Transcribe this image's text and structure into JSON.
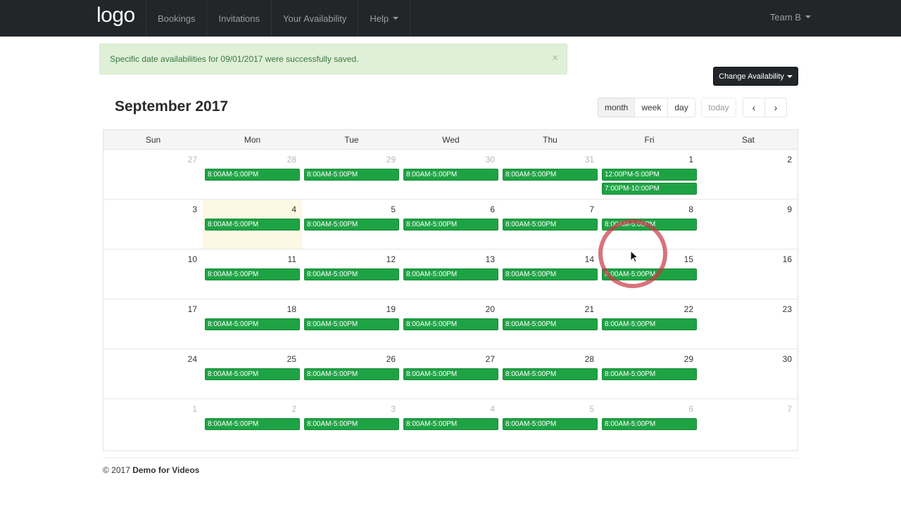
{
  "navbar": {
    "logo": "logo",
    "items": [
      {
        "label": "Bookings"
      },
      {
        "label": "Invitations"
      },
      {
        "label": "Your Availability"
      },
      {
        "label": "Help"
      }
    ],
    "team": "Team B"
  },
  "alert": {
    "message": "Specific date availabilities for 09/01/2017 were successfully saved.",
    "close": "×"
  },
  "change_availability": "Change Availability",
  "calendar": {
    "title": "September 2017",
    "views": {
      "month": "month",
      "week": "week",
      "day": "day"
    },
    "today": "today",
    "prev": "‹",
    "next": "›",
    "days_of_week": [
      "Sun",
      "Mon",
      "Tue",
      "Wed",
      "Thu",
      "Fri",
      "Sat"
    ],
    "weeks": [
      {
        "days": [
          {
            "num": "27",
            "other": true,
            "events": []
          },
          {
            "num": "28",
            "other": true,
            "events": [
              "8:00AM-5:00PM"
            ]
          },
          {
            "num": "29",
            "other": true,
            "events": [
              "8:00AM-5:00PM"
            ]
          },
          {
            "num": "30",
            "other": true,
            "events": [
              "8:00AM-5:00PM"
            ]
          },
          {
            "num": "31",
            "other": true,
            "events": [
              "8:00AM-5:00PM"
            ]
          },
          {
            "num": "1",
            "other": false,
            "events": [
              "12:00PM-5:00PM",
              "7:00PM-10:00PM"
            ]
          },
          {
            "num": "2",
            "other": false,
            "events": []
          }
        ]
      },
      {
        "days": [
          {
            "num": "3",
            "other": false,
            "events": []
          },
          {
            "num": "4",
            "other": false,
            "today": true,
            "events": [
              "8:00AM-5:00PM"
            ]
          },
          {
            "num": "5",
            "other": false,
            "events": [
              "8:00AM-5:00PM"
            ]
          },
          {
            "num": "6",
            "other": false,
            "events": [
              "8:00AM-5:00PM"
            ]
          },
          {
            "num": "7",
            "other": false,
            "events": [
              "8:00AM-5:00PM"
            ]
          },
          {
            "num": "8",
            "other": false,
            "events": [
              "8:00AM-5:00PM"
            ]
          },
          {
            "num": "9",
            "other": false,
            "events": []
          }
        ]
      },
      {
        "days": [
          {
            "num": "10",
            "other": false,
            "events": []
          },
          {
            "num": "11",
            "other": false,
            "events": [
              "8:00AM-5:00PM"
            ]
          },
          {
            "num": "12",
            "other": false,
            "events": [
              "8:00AM-5:00PM"
            ]
          },
          {
            "num": "13",
            "other": false,
            "events": [
              "8:00AM-5:00PM"
            ]
          },
          {
            "num": "14",
            "other": false,
            "events": [
              "8:00AM-5:00PM"
            ]
          },
          {
            "num": "15",
            "other": false,
            "events": [
              "8:00AM-5:00PM"
            ]
          },
          {
            "num": "16",
            "other": false,
            "events": []
          }
        ]
      },
      {
        "days": [
          {
            "num": "17",
            "other": false,
            "events": []
          },
          {
            "num": "18",
            "other": false,
            "events": [
              "8:00AM-5:00PM"
            ]
          },
          {
            "num": "19",
            "other": false,
            "events": [
              "8:00AM-5:00PM"
            ]
          },
          {
            "num": "20",
            "other": false,
            "events": [
              "8:00AM-5:00PM"
            ]
          },
          {
            "num": "21",
            "other": false,
            "events": [
              "8:00AM-5:00PM"
            ]
          },
          {
            "num": "22",
            "other": false,
            "events": [
              "8:00AM-5:00PM"
            ]
          },
          {
            "num": "23",
            "other": false,
            "events": []
          }
        ]
      },
      {
        "days": [
          {
            "num": "24",
            "other": false,
            "events": []
          },
          {
            "num": "25",
            "other": false,
            "events": [
              "8:00AM-5:00PM"
            ]
          },
          {
            "num": "26",
            "other": false,
            "events": [
              "8:00AM-5:00PM"
            ]
          },
          {
            "num": "27",
            "other": false,
            "events": [
              "8:00AM-5:00PM"
            ]
          },
          {
            "num": "28",
            "other": false,
            "events": [
              "8:00AM-5:00PM"
            ]
          },
          {
            "num": "29",
            "other": false,
            "events": [
              "8:00AM-5:00PM"
            ]
          },
          {
            "num": "30",
            "other": false,
            "events": []
          }
        ]
      },
      {
        "days": [
          {
            "num": "1",
            "other": true,
            "events": []
          },
          {
            "num": "2",
            "other": true,
            "events": [
              "8:00AM-5:00PM"
            ]
          },
          {
            "num": "3",
            "other": true,
            "events": [
              "8:00AM-5:00PM"
            ]
          },
          {
            "num": "4",
            "other": true,
            "events": [
              "8:00AM-5:00PM"
            ]
          },
          {
            "num": "5",
            "other": true,
            "events": [
              "8:00AM-5:00PM"
            ]
          },
          {
            "num": "6",
            "other": true,
            "events": [
              "8:00AM-5:00PM"
            ]
          },
          {
            "num": "7",
            "other": true,
            "events": []
          }
        ]
      }
    ]
  },
  "footer": {
    "copyright": "© 2017",
    "company": "Demo for Videos"
  },
  "colors": {
    "navbar": "#222629",
    "event_green": "#1ea344",
    "alert_bg": "#dff0d8",
    "today_bg": "#fcf8e3"
  }
}
